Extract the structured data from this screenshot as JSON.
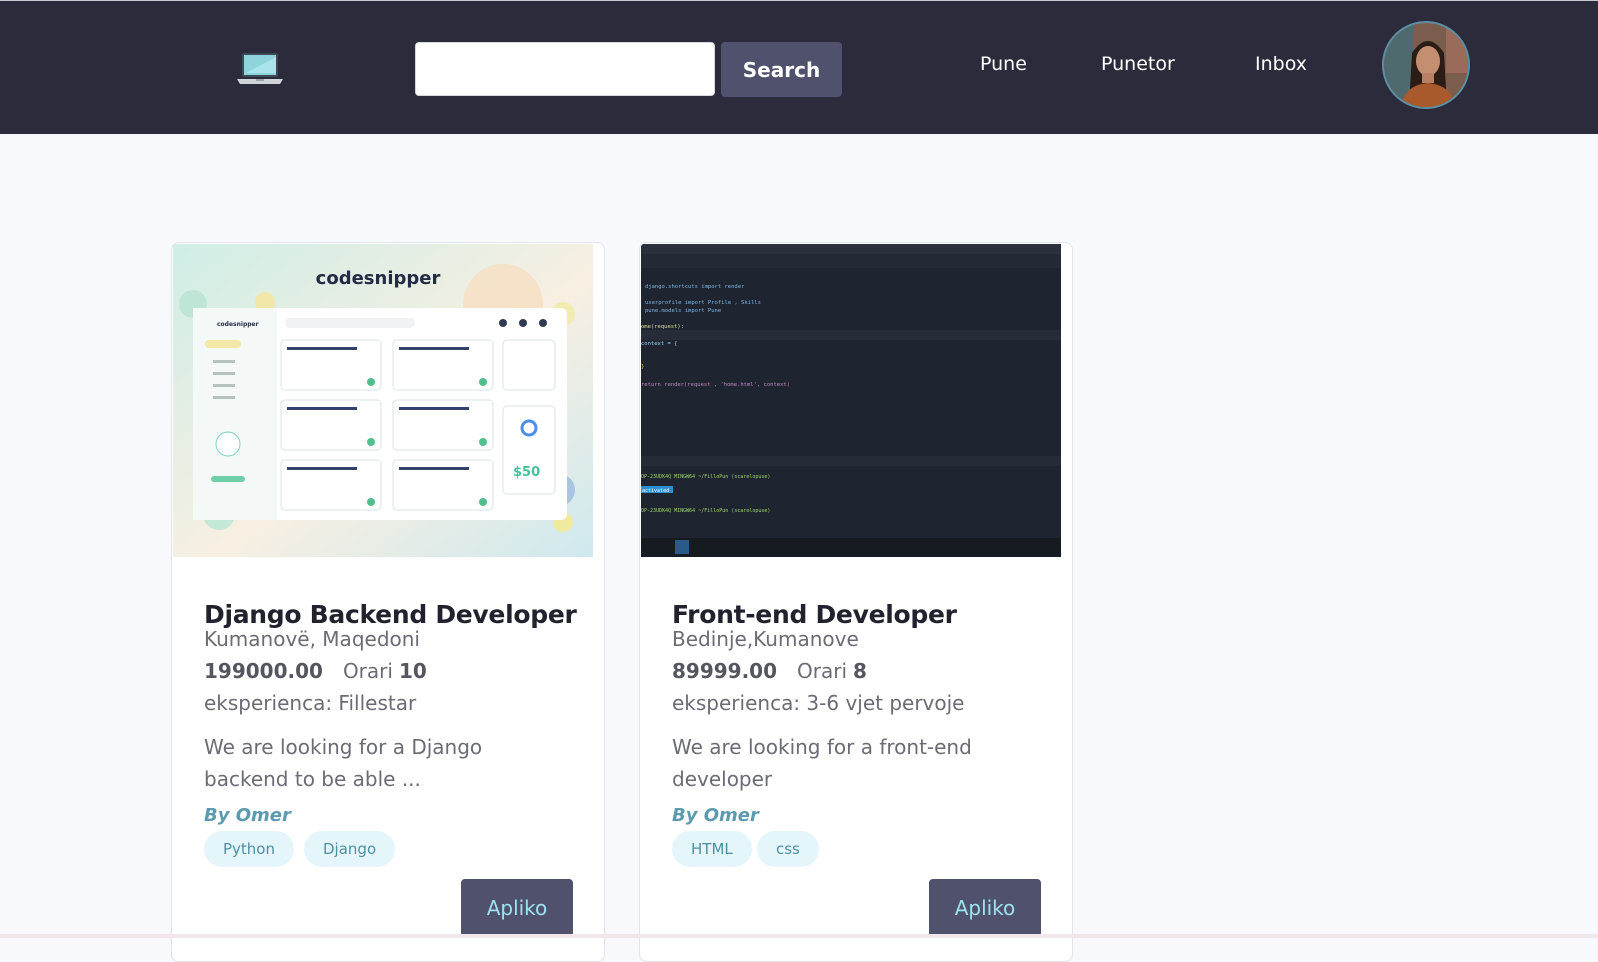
{
  "navbar": {
    "search_placeholder": "",
    "search_value": "",
    "search_label": "Search",
    "links": [
      "Pune",
      "Punetor",
      "Inbox"
    ]
  },
  "cards": [
    {
      "image_brand": "codesnipper",
      "image_price": "$50",
      "title": "Django Backend Developer",
      "location": "Kumanovë, Maqedoni",
      "salary": "199000.00",
      "orari_label": "Orari",
      "orari_value": "10",
      "experience": "eksperienca: Fillestar",
      "description": "We are looking for a Django backend to be able ...",
      "author": "By Omer",
      "tags": [
        "Python",
        "Django"
      ],
      "apply_label": "Apliko"
    },
    {
      "image_code": [
        "django.shortcuts import render",
        "userprofile import Profile , Skills",
        "pune.models import Pune",
        "ome(request):",
        "context = {",
        "}",
        "return render(request , 'home.html', context)",
        "OP-23UDK4Q MINGW64 ~/FilloPun (scarelopuse)",
        "activated",
        "OP-23UDK4Q MINGW64 ~/FilloPun (scarelopuse)"
      ],
      "title": "Front-end Developer",
      "location": "Bedinje,Kumanove",
      "salary": "89999.00",
      "orari_label": "Orari",
      "orari_value": "8",
      "experience": "eksperienca: 3-6 vjet pervoje",
      "description": "We are looking for a front-end developer",
      "author": "By Omer",
      "tags": [
        "HTML",
        "css"
      ],
      "apply_label": "Apliko"
    }
  ],
  "colors": {
    "navbar_bg": "#2b2b3c",
    "button_bg": "#50516d",
    "tag_bg": "#e5f6fb",
    "accent": "#5a9bb0"
  }
}
